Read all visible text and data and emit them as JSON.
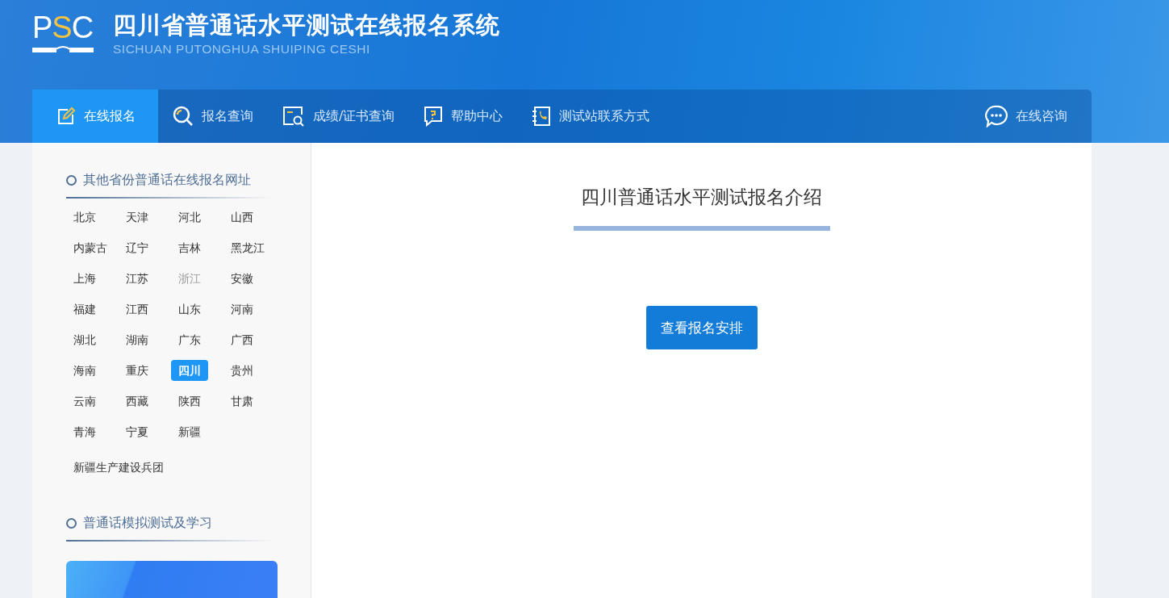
{
  "header": {
    "logo": {
      "letters": [
        "P",
        "S",
        "C"
      ]
    },
    "title": "四川省普通话水平测试在线报名系统",
    "subtitle": "SICHUAN PUTONGHUA SHUIPING CESHI"
  },
  "nav": {
    "items": [
      {
        "label": "在线报名",
        "kind": "edit",
        "selected": true
      },
      {
        "label": "报名查询",
        "kind": "search",
        "selected": false
      },
      {
        "label": "成绩/证书查询",
        "kind": "certificate",
        "selected": false
      },
      {
        "label": "帮助中心",
        "kind": "help",
        "selected": false
      },
      {
        "label": "测试站联系方式",
        "kind": "phone",
        "selected": false
      }
    ],
    "consult": {
      "label": "在线咨询"
    }
  },
  "sidebar": {
    "provinces_heading": "其他省份普通话在线报名网址",
    "provinces": [
      {
        "name": "北京",
        "selected": false,
        "disabled": false
      },
      {
        "name": "天津",
        "selected": false,
        "disabled": false
      },
      {
        "name": "河北",
        "selected": false,
        "disabled": false
      },
      {
        "name": "山西",
        "selected": false,
        "disabled": false
      },
      {
        "name": "内蒙古",
        "selected": false,
        "disabled": false
      },
      {
        "name": "辽宁",
        "selected": false,
        "disabled": false
      },
      {
        "name": "吉林",
        "selected": false,
        "disabled": false
      },
      {
        "name": "黑龙江",
        "selected": false,
        "disabled": false
      },
      {
        "name": "上海",
        "selected": false,
        "disabled": false
      },
      {
        "name": "江苏",
        "selected": false,
        "disabled": false
      },
      {
        "name": "浙江",
        "selected": false,
        "disabled": true
      },
      {
        "name": "安徽",
        "selected": false,
        "disabled": false
      },
      {
        "name": "福建",
        "selected": false,
        "disabled": false
      },
      {
        "name": "江西",
        "selected": false,
        "disabled": false
      },
      {
        "name": "山东",
        "selected": false,
        "disabled": false
      },
      {
        "name": "河南",
        "selected": false,
        "disabled": false
      },
      {
        "name": "湖北",
        "selected": false,
        "disabled": false
      },
      {
        "name": "湖南",
        "selected": false,
        "disabled": false
      },
      {
        "name": "广东",
        "selected": false,
        "disabled": false
      },
      {
        "name": "广西",
        "selected": false,
        "disabled": false
      },
      {
        "name": "海南",
        "selected": false,
        "disabled": false
      },
      {
        "name": "重庆",
        "selected": false,
        "disabled": false
      },
      {
        "name": "四川",
        "selected": true,
        "disabled": false
      },
      {
        "name": "贵州",
        "selected": false,
        "disabled": false
      },
      {
        "name": "云南",
        "selected": false,
        "disabled": false
      },
      {
        "name": "西藏",
        "selected": false,
        "disabled": false
      },
      {
        "name": "陕西",
        "selected": false,
        "disabled": false
      },
      {
        "name": "甘肃",
        "selected": false,
        "disabled": false
      },
      {
        "name": "青海",
        "selected": false,
        "disabled": false
      },
      {
        "name": "宁夏",
        "selected": false,
        "disabled": false
      },
      {
        "name": "新疆",
        "selected": false,
        "disabled": false
      }
    ],
    "extra_link": "新疆生产建设兵团",
    "study_heading": "普通话模拟测试及学习"
  },
  "main": {
    "title": "四川普通话水平测试报名介绍",
    "button": "查看报名安排"
  }
}
